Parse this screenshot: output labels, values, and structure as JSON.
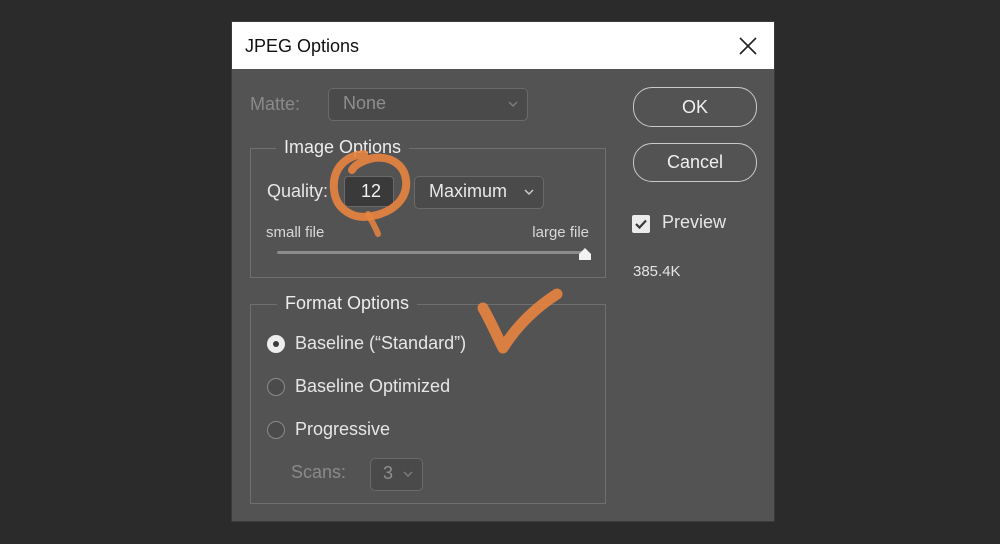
{
  "dialog": {
    "title": "JPEG Options",
    "matte": {
      "label": "Matte:",
      "value": "None"
    },
    "image_options": {
      "legend": "Image Options",
      "quality_label": "Quality:",
      "quality_value": "12",
      "preset_value": "Maximum",
      "slider_min_label": "small file",
      "slider_max_label": "large file",
      "slider_level": 1.0
    },
    "format_options": {
      "legend": "Format Options",
      "choices": [
        {
          "label": "Baseline (“Standard”)",
          "selected": true
        },
        {
          "label": "Baseline Optimized",
          "selected": false
        },
        {
          "label": "Progressive",
          "selected": false
        }
      ],
      "scans_label": "Scans:",
      "scans_value": "3"
    },
    "buttons": {
      "ok": "OK",
      "cancel": "Cancel"
    },
    "preview": {
      "label": "Preview",
      "checked": true
    },
    "file_size": "385.4K"
  },
  "colors": {
    "dialog_bg": "#535353",
    "annotation": "#e88440"
  },
  "icons": [
    "close-icon",
    "chevron-down-icon",
    "checkmark-icon"
  ]
}
